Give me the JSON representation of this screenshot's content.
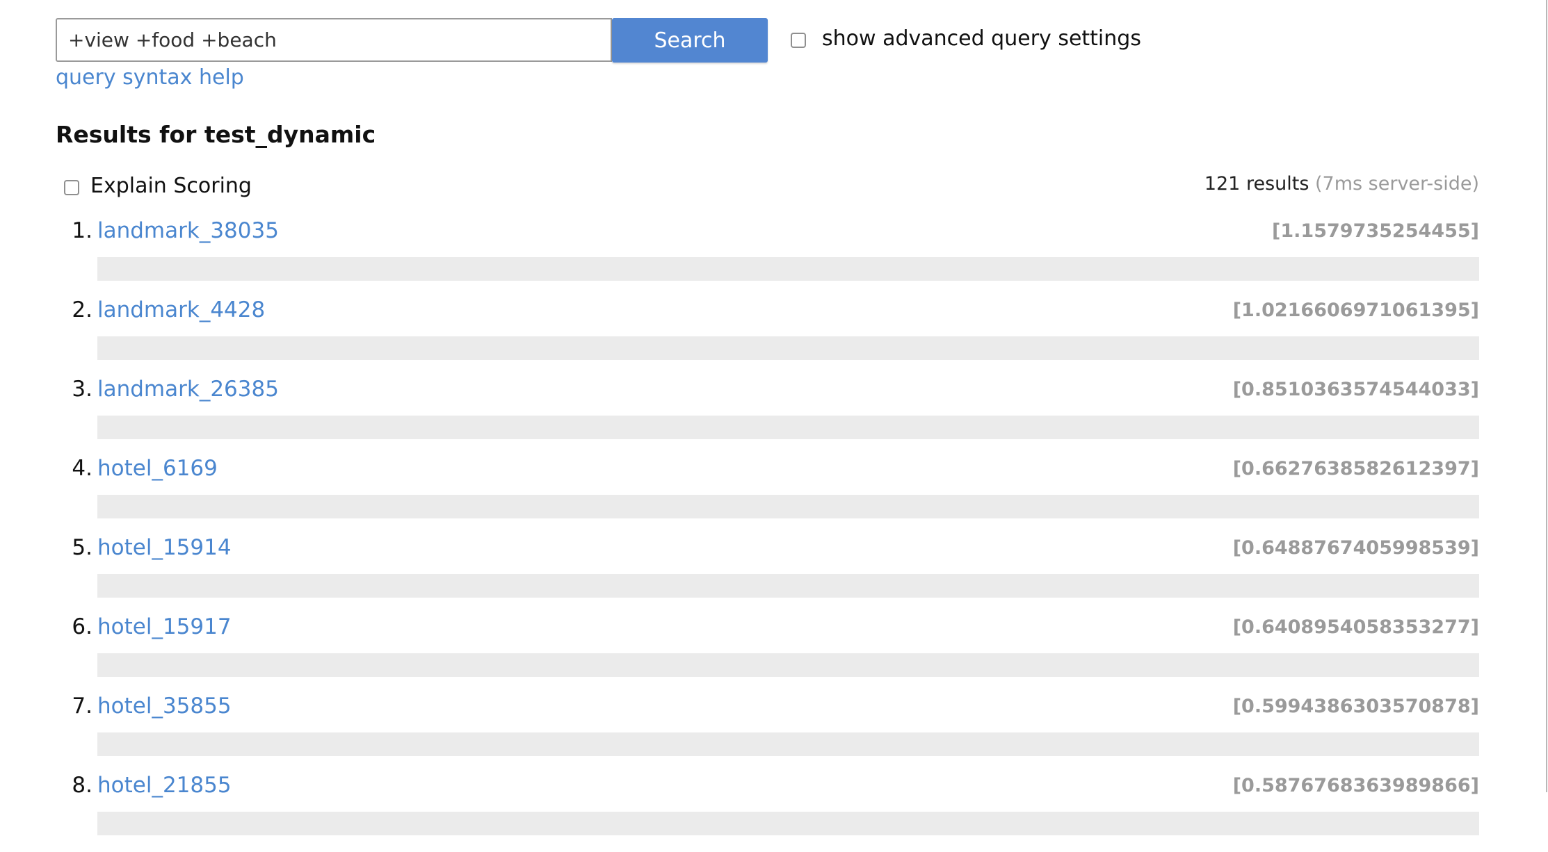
{
  "search": {
    "query": "+view +food +beach",
    "button_label": "Search",
    "advanced_label": "show advanced query settings",
    "advanced_checked": false,
    "syntax_help_label": "query syntax help"
  },
  "results": {
    "heading": "Results for test_dynamic",
    "explain_label": "Explain Scoring",
    "explain_checked": false,
    "count_label": "121 results",
    "timing_label": "(7ms server-side)",
    "items": [
      {
        "rank": "1.",
        "title": "landmark_38035",
        "score": "[1.1579735254455]"
      },
      {
        "rank": "2.",
        "title": "landmark_4428",
        "score": "[1.0216606971061395]"
      },
      {
        "rank": "3.",
        "title": "landmark_26385",
        "score": "[0.8510363574544033]"
      },
      {
        "rank": "4.",
        "title": "hotel_6169",
        "score": "[0.6627638582612397]"
      },
      {
        "rank": "5.",
        "title": "hotel_15914",
        "score": "[0.6488767405998539]"
      },
      {
        "rank": "6.",
        "title": "hotel_15917",
        "score": "[0.6408954058353277]"
      },
      {
        "rank": "7.",
        "title": "hotel_35855",
        "score": "[0.5994386303570878]"
      },
      {
        "rank": "8.",
        "title": "hotel_21855",
        "score": "[0.5876768363989866]"
      }
    ]
  },
  "colors": {
    "accent": "#5286d1",
    "link": "#4a86cf",
    "muted": "#9a9a9a",
    "bar": "#ebebeb"
  }
}
